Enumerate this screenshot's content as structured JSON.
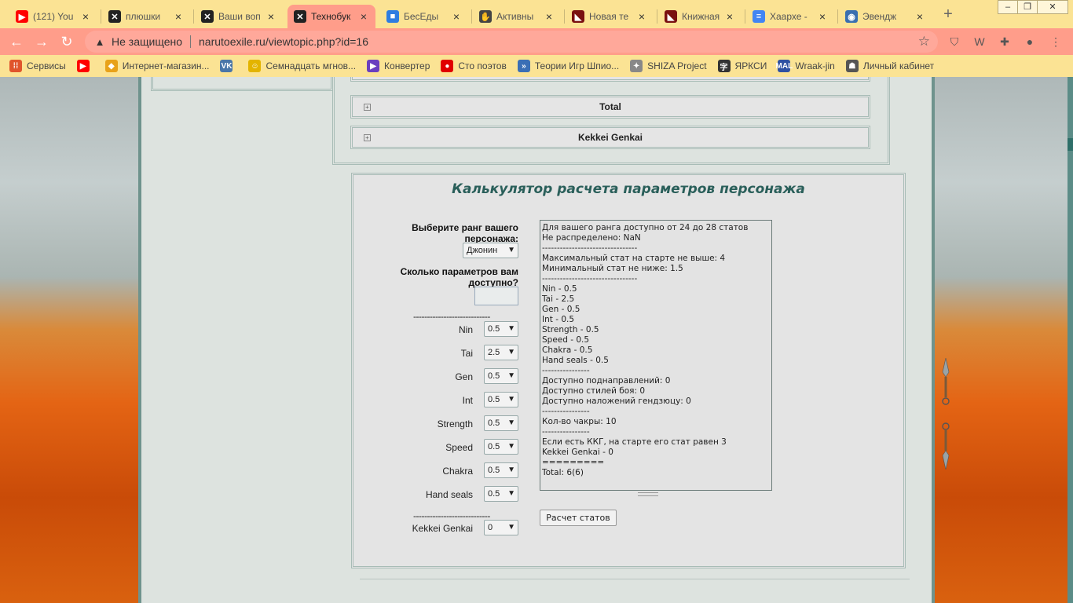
{
  "browser": {
    "tabs": [
      {
        "icon": "youtube-icon",
        "color": "#ff0000",
        "glyph": "▶",
        "title": "(121) You"
      },
      {
        "icon": "shuriken-icon",
        "color": "#222222",
        "glyph": "✕",
        "title": "плюшки"
      },
      {
        "icon": "shuriken-icon",
        "color": "#222222",
        "glyph": "✕",
        "title": "Ваши воп"
      },
      {
        "icon": "shuriken-icon",
        "color": "#222222",
        "glyph": "✕",
        "title": "Технобук",
        "active": true
      },
      {
        "icon": "chat-icon",
        "color": "#2f7de1",
        "glyph": "■",
        "title": "БесЕды"
      },
      {
        "icon": "hand-icon",
        "color": "#444444",
        "glyph": "✋",
        "title": "Активны"
      },
      {
        "icon": "site-icon",
        "color": "#7a1010",
        "glyph": "◣",
        "title": "Новая те"
      },
      {
        "icon": "site-icon",
        "color": "#7a1010",
        "glyph": "◣",
        "title": "Книжная"
      },
      {
        "icon": "docs-icon",
        "color": "#4285f4",
        "glyph": "≡",
        "title": "Хаархе -"
      },
      {
        "icon": "globe-icon",
        "color": "#3a6fb0",
        "glyph": "◉",
        "title": "Эвендж"
      }
    ],
    "tab_close": "×",
    "new_tab": "+",
    "window_controls": [
      "‒",
      "❐",
      "✕"
    ],
    "nav": {
      "back": "←",
      "forward": "→",
      "reload": "↻"
    },
    "address": {
      "security_icon": "▲",
      "security_text": "Не защищено",
      "url": "narutoexile.ru/viewtopic.php?id=16",
      "star": "☆"
    },
    "extensions": [
      {
        "name": "shield-extension-icon",
        "glyph": "⛉"
      },
      {
        "name": "w-extension-icon",
        "glyph": "W"
      },
      {
        "name": "puzzle-extension-icon",
        "glyph": "✚"
      },
      {
        "name": "profile-avatar-icon",
        "glyph": "●"
      },
      {
        "name": "menu-dots-icon",
        "glyph": "⋮"
      }
    ],
    "bookmarks": [
      {
        "icon": "apps-grid-icon",
        "color": "#e0552c",
        "glyph": "⁞⁞",
        "label": "Сервисы"
      },
      {
        "icon": "youtube-icon",
        "color": "#ff0000",
        "glyph": "▶",
        "label": ""
      },
      {
        "icon": "shop-icon",
        "color": "#e8a21a",
        "glyph": "◆",
        "label": "Интернет-магазин..."
      },
      {
        "icon": "vk-icon",
        "color": "#4a76a8",
        "glyph": "VK",
        "label": ""
      },
      {
        "icon": "smiley-icon",
        "color": "#e3b400",
        "glyph": "☺",
        "label": "Семнадцать мгнов..."
      },
      {
        "icon": "play-icon",
        "color": "#6a3fbf",
        "glyph": "▶",
        "label": "Конвертер"
      },
      {
        "icon": "record-icon",
        "color": "#e00000",
        "glyph": "●",
        "label": "Сто поэтов"
      },
      {
        "icon": "double-arrow-icon",
        "color": "#3b6fb5",
        "glyph": "»",
        "label": "Теории Игр Шпио..."
      },
      {
        "icon": "shiza-icon",
        "color": "#888888",
        "glyph": "✦",
        "label": "SHIZA Project"
      },
      {
        "icon": "yarksi-icon",
        "color": "#333333",
        "glyph": "字",
        "label": "ЯРКСИ"
      },
      {
        "icon": "mal-icon",
        "color": "#2e51a2",
        "glyph": "MAL",
        "label": "Wraak-jin"
      },
      {
        "icon": "cabinet-icon",
        "color": "#555555",
        "glyph": "☗",
        "label": "Личный кабинет"
      }
    ]
  },
  "page": {
    "spoilers": [
      {
        "title": "Total"
      },
      {
        "title": "Kekkei Genkai"
      }
    ],
    "spoiler_plus": "+",
    "calculator": {
      "title": "Калькулятор расчета параметров персонажа",
      "rank_label": "Выберите ранг вашего персонажа:",
      "rank_value": "Джонин",
      "count_label": "Сколько параметров вам доступно?",
      "separator": "----------------------------",
      "stats": [
        {
          "name": "Nin",
          "value": "0.5"
        },
        {
          "name": "Tai",
          "value": "2.5"
        },
        {
          "name": "Gen",
          "value": "0.5"
        },
        {
          "name": "Int",
          "value": "0.5"
        },
        {
          "name": "Strength",
          "value": "0.5"
        },
        {
          "name": "Speed",
          "value": "0.5"
        },
        {
          "name": "Chakra",
          "value": "0.5"
        },
        {
          "name": "Hand seals",
          "value": "0.5"
        }
      ],
      "kekkei_label": "Kekkei Genkai",
      "kekkei_value": "0",
      "result_lines": [
        "Для вашего ранга доступно от 24 до 28 статов",
        "Не распределено: NaN",
        "--------------------------------",
        "Максимальный стат на старте не выше: 4",
        "Минимальный стат не ниже: 1.5",
        "--------------------------------",
        "Nin - 0.5",
        "Tai - 2.5",
        "Gen - 0.5",
        "Int - 0.5",
        "Strength - 0.5",
        "Speed - 0.5",
        "Chakra - 0.5",
        "Hand seals - 0.5",
        "----------------",
        "Доступно поднаправлений: 0",
        "Доступно стилей боя: 0",
        "Доступно наложений гендзюцу: 0",
        "----------------",
        "Кол-во чакры: 10",
        "----------------",
        "Если есть ККГ, на старте его стат равен 3",
        "Kekkei Genkai - 0",
        "=========",
        "Total: 6(6)"
      ],
      "button_label": "Расчет статов"
    }
  },
  "colors": {
    "tab_strip": "#fbe394",
    "toolbar": "#ff9d8a",
    "title_teal": "#2a5f5a",
    "frame_teal": "#6f938d"
  }
}
